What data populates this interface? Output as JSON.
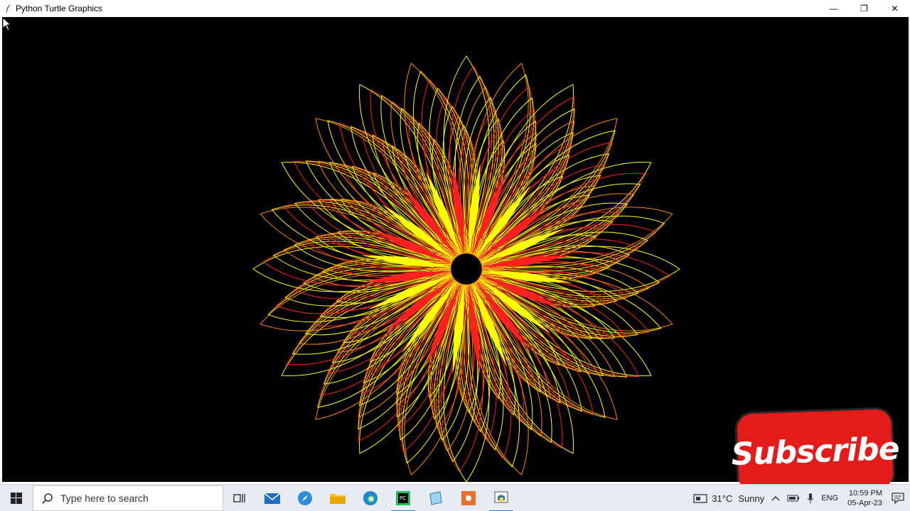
{
  "window": {
    "title": "Python Turtle Graphics",
    "minimize_glyph": "—",
    "restore_glyph": "❐",
    "close_glyph": "✕"
  },
  "canvas": {
    "background": "#000000",
    "pattern": "spirograph flower",
    "colors": [
      "#ffff00",
      "#ff2020",
      "#ff8800"
    ]
  },
  "overlay": {
    "subscribe_label": "Subscribe"
  },
  "taskbar": {
    "search_placeholder": "Type here to search",
    "apps": [
      "task-view",
      "mail",
      "safari",
      "file-explorer",
      "edge",
      "pycharm",
      "notepad",
      "app-orange",
      "python-turtle"
    ],
    "weather_temp": "31°C",
    "weather_text": "Sunny",
    "language": "ENG",
    "time": "10:59 PM",
    "date": "05-Apr-23"
  }
}
